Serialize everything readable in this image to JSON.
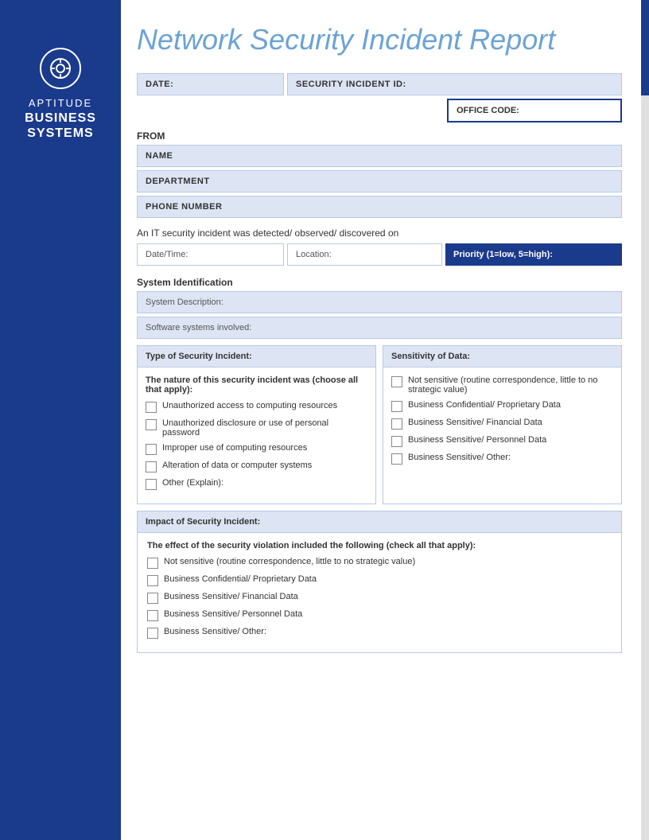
{
  "title": "Network Security Incident Report",
  "sidebar": {
    "aptitude_label": "APTITUDE",
    "business_label": "BUSINESS SYSTEMS"
  },
  "form": {
    "date_label": "DATE:",
    "security_incident_id_label": "SECURITY INCIDENT ID:",
    "office_code_label": "OFFICE CODE:",
    "from_label": "FROM",
    "name_label": "NAME",
    "department_label": "DEPARTMENT",
    "phone_label": "PHONE NUMBER",
    "detection_text": "An IT security incident was detected/ observed/ discovered on",
    "date_time_label": "Date/Time:",
    "location_label": "Location:",
    "priority_label": "Priority (1=low, 5=high):",
    "system_identification_label": "System Identification",
    "system_description_label": "System Description:",
    "software_systems_label": "Software systems involved:",
    "type_of_security_incident_label": "Type of Security Incident:",
    "sensitivity_of_data_label": "Sensitivity of Data:",
    "nature_text": "The nature of this security incident was (choose all that apply):",
    "type_checkboxes": [
      "Unauthorized access to computing resources",
      "Unauthorized disclosure or use of personal password",
      "Improper use of computing resources",
      "Alteration of data or computer systems",
      "Other (Explain):"
    ],
    "sensitivity_checkboxes": [
      "Not sensitive (routine correspondence, little to no strategic value)",
      "Business Confidential/ Proprietary Data",
      "Business Sensitive/ Financial Data",
      "Business Sensitive/ Personnel Data",
      "Business Sensitive/ Other:"
    ],
    "impact_label": "Impact of Security Incident:",
    "impact_intro": "The effect of the security violation included the following (check all that apply):",
    "impact_checkboxes": [
      "Not sensitive (routine correspondence, little to no strategic value)",
      "Business Confidential/ Proprietary Data",
      "Business Sensitive/ Financial Data",
      "Business Sensitive/ Personnel Data",
      "Business Sensitive/ Other:"
    ]
  }
}
